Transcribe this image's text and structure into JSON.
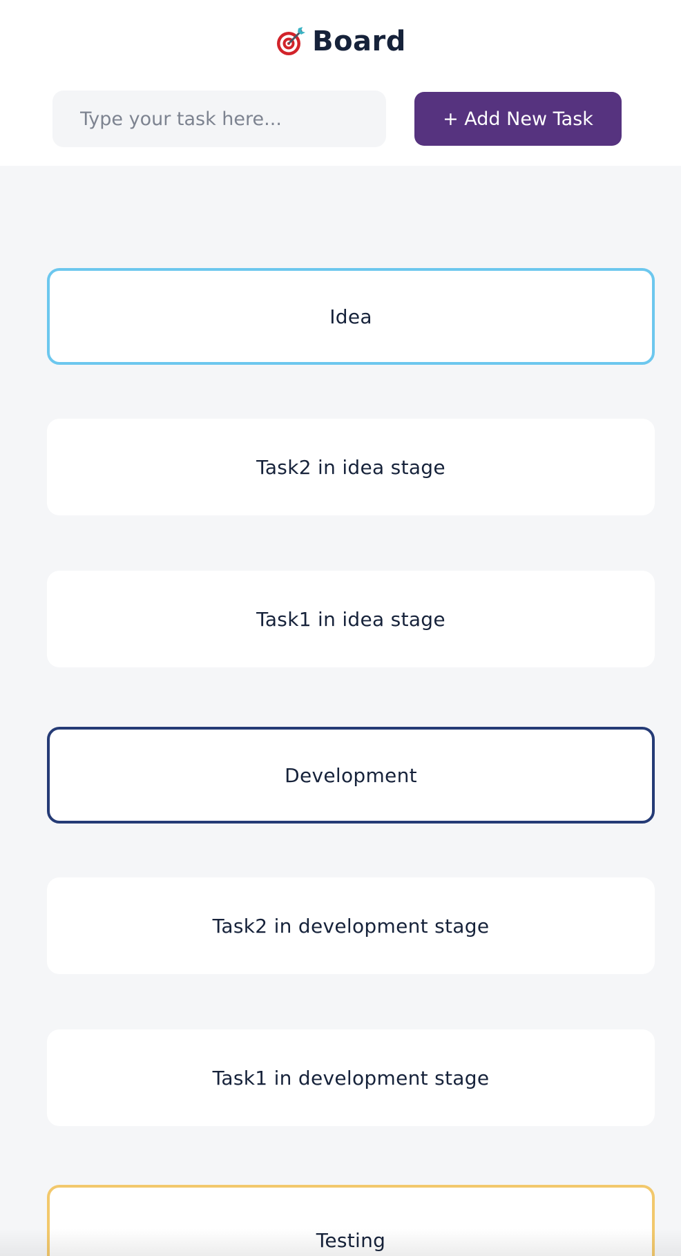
{
  "header": {
    "title": "Board",
    "title_icon": "dart-target-icon",
    "input_placeholder": "Type your task here...",
    "input_value": "",
    "add_button_label": "+ Add New Task"
  },
  "board": {
    "stages": [
      {
        "name": "Idea",
        "accent": "#6cc7ee",
        "tasks": [
          "Task2 in idea stage",
          "Task1 in idea stage"
        ]
      },
      {
        "name": "Development",
        "accent": "#253b76",
        "tasks": [
          "Task2 in development stage",
          "Task1 in development stage"
        ]
      },
      {
        "name": "Testing",
        "accent": "#f2c86c",
        "tasks": []
      }
    ]
  },
  "colors": {
    "add_button": "#56337f",
    "page_background": "#f5f6f8",
    "text": "#16223a"
  }
}
